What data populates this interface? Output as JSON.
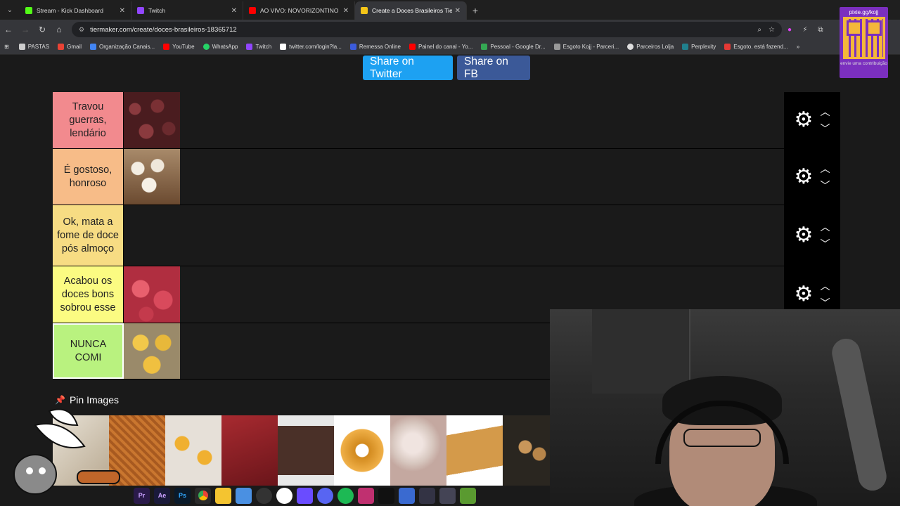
{
  "tabs": [
    {
      "title": "Stream - Kick Dashboard",
      "color": "#53fc18",
      "active": false
    },
    {
      "title": "Twitch",
      "color": "#9146ff",
      "active": false
    },
    {
      "title": "AO VIVO: NOVORIZONTINO X",
      "color": "#ff0000",
      "active": false
    },
    {
      "title": "Create a Doces Brasileiros Tier l",
      "color": "#f5c518",
      "active": true
    }
  ],
  "address": {
    "url": "tiermaker.com/create/doces-brasileiros-18365712"
  },
  "bookmarks": [
    {
      "label": "PASTAS",
      "color": "#cccccc"
    },
    {
      "label": "Gmail",
      "color": "#ea4335"
    },
    {
      "label": "Organização Canais...",
      "color": "#4285f4"
    },
    {
      "label": "YouTube",
      "color": "#ff0000"
    },
    {
      "label": "WhatsApp",
      "color": "#25d366"
    },
    {
      "label": "Twitch",
      "color": "#9146ff"
    },
    {
      "label": "twitter.com/login?la...",
      "color": "#ffffff"
    },
    {
      "label": "Remessa Online",
      "color": "#3b5bdb"
    },
    {
      "label": "Painel do canal - Yo...",
      "color": "#ff0000"
    },
    {
      "label": "Pessoal - Google Dr...",
      "color": "#34a853"
    },
    {
      "label": "Esgoto Kojj - Parceri...",
      "color": "#999999"
    },
    {
      "label": "Parceiros Lolja",
      "color": "#dddddd"
    },
    {
      "label": "Perplexity",
      "color": "#20808d"
    },
    {
      "label": "Esgoto. está fazend...",
      "color": "#e53935"
    }
  ],
  "share": {
    "twitter": "Share on Twitter",
    "facebook": "Share on FB"
  },
  "tiers": [
    {
      "label": "Travou guerras, lendário",
      "color": "#f28a8e",
      "items": [
        "#6b2a2e"
      ]
    },
    {
      "label": "É gostoso, honroso",
      "color": "#f7bc88",
      "items": [
        "#c9b9a0"
      ]
    },
    {
      "label": "Ok, mata a fome de doce pós almoço",
      "color": "#f7dc83",
      "items": []
    },
    {
      "label": "Acabou os doces bons sobrou esse",
      "color": "#fbfb82",
      "items": [
        "#d94a5c"
      ]
    },
    {
      "label": "NUNCA COMI",
      "color": "#b9f27f",
      "items": [
        "#e8b83a"
      ]
    }
  ],
  "pin_label": "Pin Images",
  "pool_colors": [
    "#e8e2d6",
    "#c9762f",
    "#f0b030",
    "#8c1d22",
    "#4a3028",
    "#d28a1e",
    "#d8c8c0",
    "#d49a4a",
    "#a87a48"
  ],
  "overlay": {
    "qr_title": "pixie.gg/kojj",
    "qr_subtitle": "envie uma contribuição"
  },
  "taskbar": [
    "Pr",
    "Ae",
    "Ps"
  ]
}
